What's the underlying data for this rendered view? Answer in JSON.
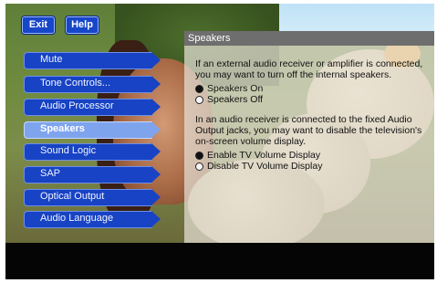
{
  "top_buttons": {
    "exit": "Exit",
    "help": "Help"
  },
  "menu": {
    "items": [
      {
        "label": "Mute",
        "selected": false
      },
      {
        "label": "Tone Controls...",
        "selected": false
      },
      {
        "label": "Audio Processor",
        "selected": false
      },
      {
        "label": "Speakers",
        "selected": true
      },
      {
        "label": "Sound Logic",
        "selected": false
      },
      {
        "label": "SAP",
        "selected": false
      },
      {
        "label": "Optical Output",
        "selected": false
      },
      {
        "label": "Audio Language",
        "selected": false
      }
    ]
  },
  "panel": {
    "title": "Speakers",
    "intro": "If an external audio receiver or amplifier is connected, you may want to turn off the internal speakers.",
    "speaker_options": [
      {
        "label": "Speakers On",
        "selected": true
      },
      {
        "label": "Speakers Off",
        "selected": false
      }
    ],
    "volume_text": "In an audio receiver is connected to the fixed Audio Output jacks, you may want to disable the television's on-screen volume display.",
    "volume_options": [
      {
        "label": "Enable TV Volume Display",
        "selected": true
      },
      {
        "label": "Disable TV Volume Display",
        "selected": false
      }
    ]
  },
  "colors": {
    "menu_bar": "#1743c4",
    "menu_selected": "#7fa4ee",
    "title_bar": "#6e6e6e"
  }
}
